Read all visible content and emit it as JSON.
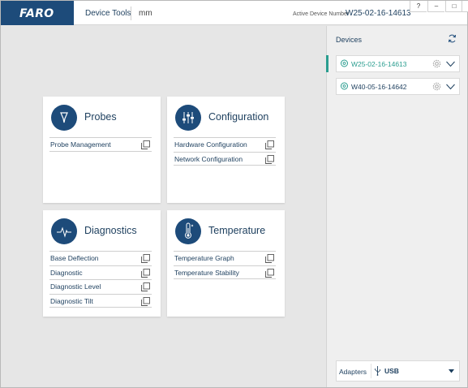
{
  "app": {
    "logo_text": "FARO",
    "section": "Device Tools",
    "units": "mm"
  },
  "header": {
    "active_label": "Active Device Number",
    "active_value": "W25-02-16-14613"
  },
  "window_controls": {
    "help": "?",
    "minimize": "–",
    "maximize": "□",
    "close": "✕"
  },
  "cards": {
    "probes": {
      "title": "Probes",
      "icon": "probe-icon",
      "items": [
        "Probe Management"
      ]
    },
    "configuration": {
      "title": "Configuration",
      "icon": "sliders-icon",
      "items": [
        "Hardware Configuration",
        "Network Configuration"
      ]
    },
    "diagnostics": {
      "title": "Diagnostics",
      "icon": "waveform-icon",
      "items": [
        "Base Deflection",
        "Diagnostic",
        "Diagnostic Level",
        "Diagnostic Tilt"
      ]
    },
    "temperature": {
      "title": "Temperature",
      "icon": "thermometer-icon",
      "items": [
        "Temperature Graph",
        "Temperature Stability"
      ]
    }
  },
  "devices": {
    "title": "Devices",
    "list": [
      {
        "name": "W25-02-16-14613",
        "active": true
      },
      {
        "name": "W40-05-16-14642",
        "active": false
      }
    ]
  },
  "adapters": {
    "label": "Adapters",
    "value": "USB"
  },
  "colors": {
    "brand": "#1d4b7a",
    "text": "#1d3f5e",
    "accent": "#2a9d8f",
    "background": "#e6e6e6"
  }
}
